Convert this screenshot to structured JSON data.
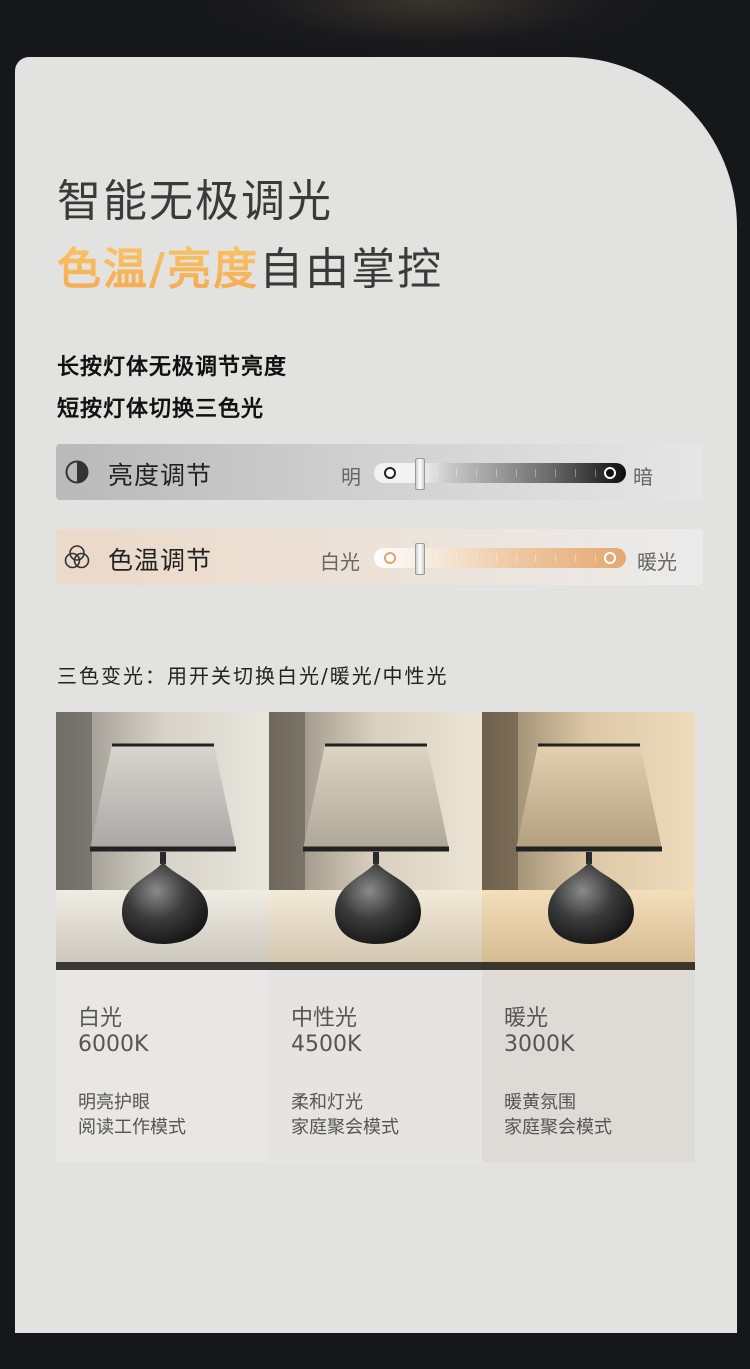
{
  "headline": {
    "line1": "智能无极调光",
    "line2_accent": "色温/亮度",
    "line2_rest": "自由掌控"
  },
  "instructions": {
    "long_press": "长按灯体无极调节亮度",
    "short_press": "短按灯体切换三色光"
  },
  "controls": {
    "brightness": {
      "label": "亮度调节",
      "left": "明",
      "right": "暗",
      "icon": "half-circle-icon",
      "handle_position": 0.18
    },
    "color_temp": {
      "label": "色温调节",
      "left": "白光",
      "right": "暖光",
      "icon": "overlapping-circles-icon",
      "handle_position": 0.18
    }
  },
  "three_color": {
    "title": "三色变光：用开关切换白光/暖光/中性光",
    "modes": [
      {
        "name": "白光",
        "kelvin": "6000K",
        "desc1": "明亮护眼",
        "desc2": "阅读工作模式",
        "tone": "#f2f1ee"
      },
      {
        "name": "中性光",
        "kelvin": "4500K",
        "desc1": "柔和灯光",
        "desc2": "家庭聚会模式",
        "tone": "#f3ead9"
      },
      {
        "name": "暖光",
        "kelvin": "3000K",
        "desc1": "暖黄氛围",
        "desc2": "家庭聚会模式",
        "tone": "#f2dfbd"
      }
    ]
  },
  "colors": {
    "accent": "#f7b55a",
    "card_bg": "#e2e2e1",
    "page_bg": "#16171b"
  }
}
